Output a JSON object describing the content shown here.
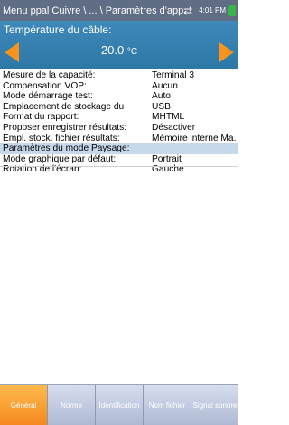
{
  "status": {
    "breadcrumb": "Menu ppal Cuivre \\ ... \\ Paramètres d'application",
    "time": "4:01 PM"
  },
  "temperature": {
    "title": "Température du câble:",
    "value": "20.0",
    "unit": "°C"
  },
  "settings": [
    {
      "label": "Mesure de la capacité:",
      "value": "Terminal 3"
    },
    {
      "label": "Compensation VOP:",
      "value": "Aucun"
    },
    {
      "label": "Mode démarrage test:",
      "value": "Auto"
    },
    {
      "label": "Emplacement de stockage du",
      "value": "USB"
    },
    {
      "label": "Format du rapport:",
      "value": "MHTML"
    },
    {
      "label": "Proposer enregistrer résultats:",
      "value": "Désactiver"
    },
    {
      "label": "Empl. stock. fichier résultats:",
      "value": "Mémoire interne Ma.."
    }
  ],
  "landscape": {
    "header": "Paramètres du mode Paysage:",
    "items": [
      {
        "label": "Mode graphique par défaut:",
        "value": "Portrait"
      },
      {
        "label": "Rotation de l'écran:",
        "value": "Gauche"
      }
    ]
  },
  "tabs": [
    "Général",
    "Norme",
    "Identification",
    "Nom fichier",
    "Signal sonore"
  ],
  "colors": {
    "status_bg": "#5f6d85",
    "panel_bg": "#3583b3",
    "arrow": "#f7941d",
    "header_bg": "#c5d8ec",
    "tab_active": "#f4891f",
    "battery": "#39b54a"
  },
  "icons": [
    "sync-icon",
    "battery-icon",
    "arrow-left-icon",
    "arrow-right-icon"
  ]
}
